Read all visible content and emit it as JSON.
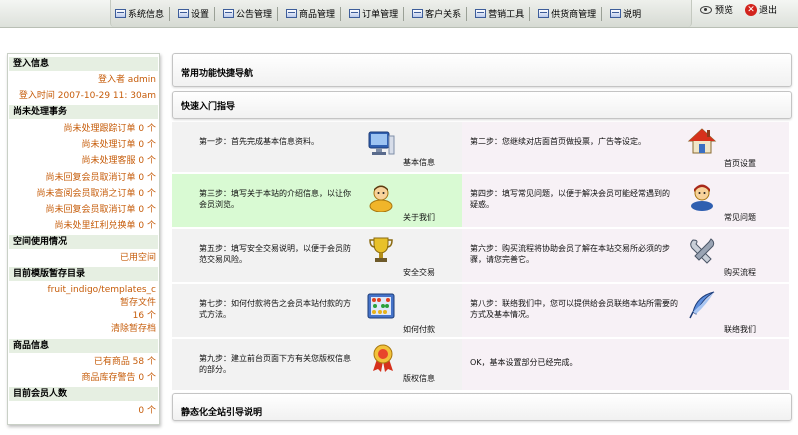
{
  "menu": {
    "items": [
      {
        "label": "系统信息"
      },
      {
        "label": "设置"
      },
      {
        "label": "公告管理"
      },
      {
        "label": "商品管理"
      },
      {
        "label": "订单管理"
      },
      {
        "label": "客户关系"
      },
      {
        "label": "营销工具"
      },
      {
        "label": "供货商管理"
      },
      {
        "label": "说明"
      }
    ],
    "preview_label": "预览",
    "exit_label": "退出"
  },
  "sidebar": {
    "login": {
      "title": "登入信息",
      "user": "登入者 admin",
      "time": "登入时间 2007-10-29 11: 30am"
    },
    "pending": {
      "title": "尚未处理事务",
      "items": [
        "尚未处理跟踪订单 0 个",
        "尚未处理订单 0 个",
        "尚未处理客服 0 个",
        "尚未回复会员取消订单 0 个",
        "尚未查阅会员取消之订单 0 个",
        "尚未回复会员取消订单 0 个",
        "尚未处里红利兑换单 0 个"
      ]
    },
    "space": {
      "title": "空间使用情况",
      "used": "已用空间"
    },
    "template": {
      "title": "目前模版暂存目录",
      "path": "fruit_indigo/templates_c",
      "temp_label": "暂存文件",
      "count": "16 个",
      "clear": "清除暂存档"
    },
    "goods": {
      "title": "商品信息",
      "existing": "已有商品 58 个",
      "stock_alert": "商品库存警告 0 个"
    },
    "members": {
      "title": "目前会员人数",
      "count": "0 个"
    }
  },
  "main": {
    "shortcut_title": "常用功能快捷导航",
    "guide_title": "快速入门指导",
    "static_title": "静态化全站引导说明",
    "steps": [
      {
        "text": "第一步：首先完成基本信息资料。",
        "icon": "monitor-icon",
        "label": "基本信息"
      },
      {
        "text": "第二步：您继续对店面首页做投票，广告等设定。",
        "icon": "house-icon",
        "label": "首页设置"
      },
      {
        "text": "第三步：填写关于本站的介绍信息，以让你会员浏览。",
        "icon": "person-icon",
        "label": "关于我们"
      },
      {
        "text": "第四步：填写常见问题，以便于解决会员可能经常遇到的疑惑。",
        "icon": "support-person-icon",
        "label": "常见问题"
      },
      {
        "text": "第五步：填写安全交易说明，以便于会员防范交易风险。",
        "icon": "trophy-icon",
        "label": "安全交易"
      },
      {
        "text": "第六步：购买流程将协助会员了解在本站交易所必须的步骤，请您完善它。",
        "icon": "wrench-icon",
        "label": "购买流程"
      },
      {
        "text": "第七步：如何付款将告之会员本站付款的方式方法。",
        "icon": "abacus-icon",
        "label": "如何付款"
      },
      {
        "text": "第八步：联络我们中，您可以提供给会员联络本站所需要的方式及基本情况。",
        "icon": "quill-icon",
        "label": "联络我们"
      },
      {
        "text": "第九步：建立前台页面下方有关您版权信息的部分。",
        "icon": "medal-icon",
        "label": "版权信息"
      }
    ],
    "done_text": "OK，基本设置部分已经完成。"
  },
  "colors": {
    "sidebar_header": "#e6efe2",
    "sidebar_text": "#c65c0a",
    "cell_left": "#f2f2f2",
    "cell_right": "#f7f1f6",
    "cell_highlight": "#d9fad3",
    "done_text": "#c61010"
  }
}
